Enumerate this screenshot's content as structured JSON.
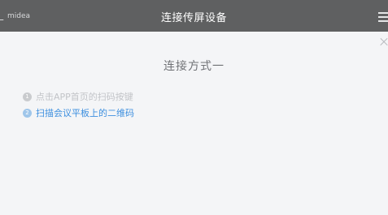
{
  "topbar": {
    "brand": "midea",
    "title": "连接传屏设备",
    "menu_icon": "hamburger-menu-icon",
    "close_icon": "close-icon"
  },
  "content": {
    "section_title": "连接方式一",
    "steps": [
      {
        "number": "1",
        "text": "点击APP首页的扫码按键",
        "state": "done"
      },
      {
        "number": "2",
        "text": "扫描会议平板上的二维码",
        "state": "active"
      }
    ]
  },
  "colors": {
    "topbar_bg": "#5f6061",
    "page_bg": "#f4f5f7",
    "active_step": "#3d8fdf",
    "done_step": "#c2c4c8"
  }
}
